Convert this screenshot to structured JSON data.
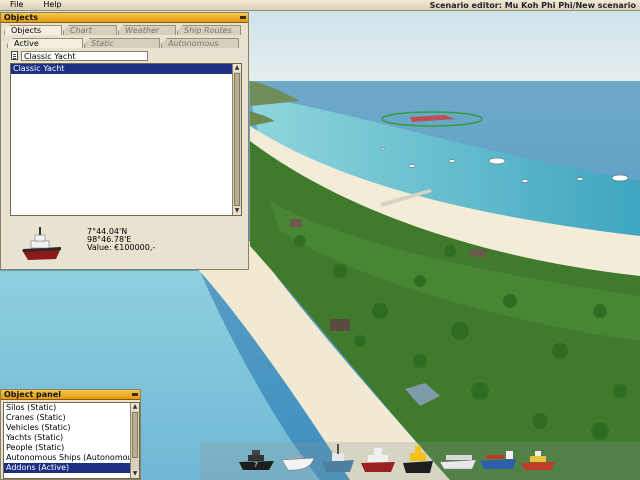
{
  "menubar": {
    "items": [
      "File",
      "Help"
    ],
    "title": "Scenario editor: Mu Koh Phi Phi/New scenario"
  },
  "objects_panel": {
    "title": "Objects",
    "tabs": [
      "Objects",
      "Chart",
      "Weather",
      "Ship Routes"
    ],
    "subtabs": [
      "Active",
      "Static",
      "Autonomous"
    ],
    "search_value": "Classic Yacht",
    "list": [
      "Classic Yacht"
    ],
    "selected_index": 0,
    "info": {
      "lat": "7°44.04'N",
      "lon": "98°46.78'E",
      "value": "Value: €100000,-"
    }
  },
  "object_panel": {
    "title": "Object panel",
    "items": [
      "Silos (Static)",
      "Cranes (Static)",
      "Vehicles (Static)",
      "Yachts (Static)",
      "People (Static)",
      "Autonomous Ships (Autonomous)",
      "Addons (Active)"
    ],
    "selected_index": 6
  },
  "ship_toolbar": {
    "items": [
      "classic-yacht",
      "speedboat",
      "fishing-boat",
      "tug-boat",
      "pilot-boat",
      "cruise-ship",
      "container-ship",
      "harbor-boat"
    ]
  },
  "colors": {
    "panel_header": "#f0b02c",
    "selection": "#1c2f84",
    "panel_bg": "#e8e2d0"
  }
}
